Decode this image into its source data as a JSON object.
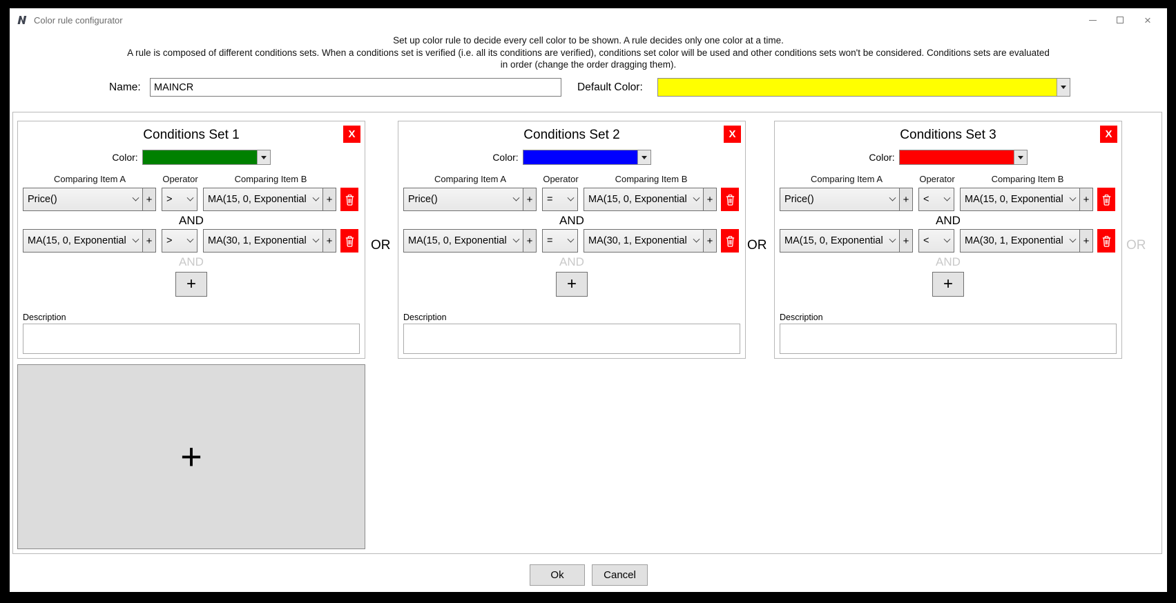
{
  "window": {
    "title": "Color rule configurator"
  },
  "icons": {
    "close_glyph": "×"
  },
  "instructions": {
    "line1": "Set up color rule to decide every cell color to be shown. A rule decides only one color at a time.",
    "line2": "A rule is composed of different conditions sets. When a conditions set is verified (i.e. all its conditions are verified), conditions set color will be used and other conditions sets won't be considered. Conditions sets are evaluated",
    "line3": "in order (change the order dragging them)."
  },
  "name_field": {
    "label": "Name:",
    "value": "MAINCR"
  },
  "default_color_field": {
    "label": "Default Color:",
    "color": "#FFFF00"
  },
  "column_headers": {
    "item_a": "Comparing Item A",
    "operator": "Operator",
    "item_b": "Comparing Item B"
  },
  "labels": {
    "color": "Color:",
    "and": "AND",
    "or": "OR",
    "description": "Description",
    "add": "+",
    "remove_set": "X"
  },
  "sets": [
    {
      "title": "Conditions Set 1",
      "color": "#008000",
      "rows": [
        {
          "item_a": "Price()",
          "operator": ">",
          "item_b": "MA(15, 0, Exponential"
        },
        {
          "item_a": "MA(15, 0, Exponential",
          "operator": ">",
          "item_b": "MA(30, 1, Exponential"
        }
      ],
      "description": ""
    },
    {
      "title": "Conditions Set 2",
      "color": "#0000FF",
      "rows": [
        {
          "item_a": "Price()",
          "operator": "=",
          "item_b": "MA(15, 0, Exponential"
        },
        {
          "item_a": "MA(15, 0, Exponential",
          "operator": "=",
          "item_b": "MA(30, 1, Exponential"
        }
      ],
      "description": ""
    },
    {
      "title": "Conditions Set 3",
      "color": "#FF0000",
      "rows": [
        {
          "item_a": "Price()",
          "operator": "<",
          "item_b": "MA(15, 0, Exponential"
        },
        {
          "item_a": "MA(15, 0, Exponential",
          "operator": "<",
          "item_b": "MA(30, 1, Exponential"
        }
      ],
      "description": ""
    }
  ],
  "footer": {
    "ok": "Ok",
    "cancel": "Cancel"
  }
}
